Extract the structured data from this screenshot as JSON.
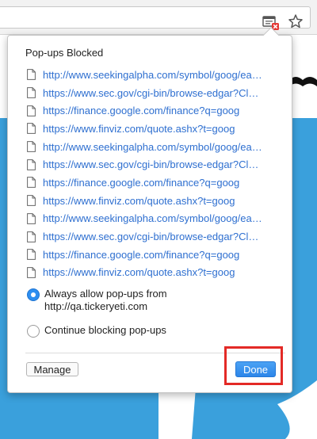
{
  "popup": {
    "title": "Pop-ups Blocked",
    "urls": [
      "http://www.seekingalpha.com/symbol/goog/ea…",
      "https://www.sec.gov/cgi-bin/browse-edgar?Cl…",
      "https://finance.google.com/finance?q=goog",
      "https://www.finviz.com/quote.ashx?t=goog",
      "http://www.seekingalpha.com/symbol/goog/ea…",
      "https://www.sec.gov/cgi-bin/browse-edgar?Cl…",
      "https://finance.google.com/finance?q=goog",
      "https://www.finviz.com/quote.ashx?t=goog",
      "http://www.seekingalpha.com/symbol/goog/ea…",
      "https://www.sec.gov/cgi-bin/browse-edgar?Cl…",
      "https://finance.google.com/finance?q=goog",
      "https://www.finviz.com/quote.ashx?t=goog"
    ],
    "options": {
      "allow_label": "Always allow pop-ups from http://qa.tickeryeti.com",
      "block_label": "Continue blocking pop-ups",
      "selected": "allow"
    },
    "manage_label": "Manage",
    "done_label": "Done"
  },
  "toolbar": {
    "icons": [
      "popup-blocked-icon",
      "bookmark-star-icon"
    ]
  },
  "colors": {
    "link": "#2e6fd0",
    "accent": "#2d8ef0",
    "page_band": "#3aa0dc",
    "highlight": "#e32a26"
  }
}
